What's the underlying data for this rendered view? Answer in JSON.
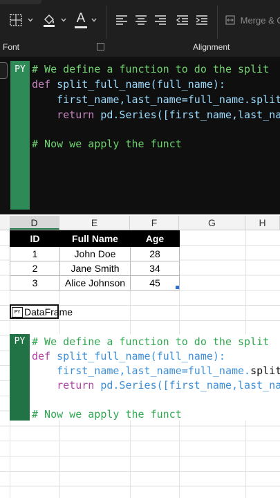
{
  "ribbon": {
    "groups": {
      "font": "Font",
      "alignment": "Alignment"
    },
    "merge_label": "Merge & C",
    "icons": [
      "borders-icon",
      "fill-color-icon",
      "font-color-icon",
      "align-left-icon",
      "align-center-icon",
      "align-right-icon",
      "decrease-indent-icon",
      "increase-indent-icon",
      "merge-icon"
    ],
    "font_color_glyph": "A"
  },
  "editor": {
    "badge": "PY",
    "lines": [
      "# We define a function to do the split",
      "def split_full_name(full_name):",
      "    first_name,last_name=full_name.split",
      "    return pd.Series([first_name,last_na",
      "",
      "# Now we apply the funct"
    ]
  },
  "sheet": {
    "columns": [
      "D",
      "E",
      "F",
      "G",
      "H"
    ],
    "selected_column": "D",
    "table": {
      "headers": [
        "ID",
        "Full Name",
        "Age"
      ],
      "rows": [
        [
          "1",
          "John Doe",
          "28"
        ],
        [
          "2",
          "Jane Smith",
          "34"
        ],
        [
          "3",
          "Alice Johnson",
          "45"
        ]
      ]
    },
    "dataframe_cell": {
      "icon": "PY",
      "label": "DataFrame"
    }
  },
  "cell_code": {
    "badge": "PY",
    "lines": [
      "# We define a function to do the split",
      "def split_full_name(full_name):",
      "    first_name,last_name=full_name.split(",
      "    return pd.Series([first_name,last_nam",
      "",
      "# Now we apply the funct"
    ]
  },
  "colors": {
    "excel_green": "#217346",
    "ribbon_bg": "#1f1f1f"
  }
}
